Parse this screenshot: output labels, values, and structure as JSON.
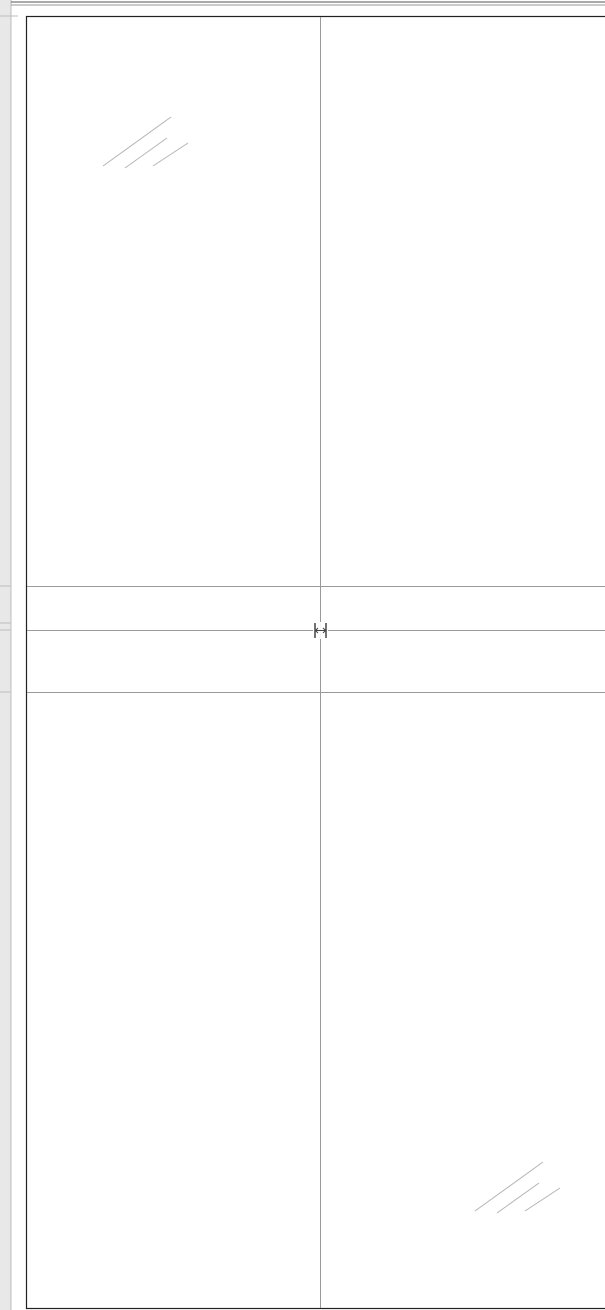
{
  "drawing": {
    "type": "elevation",
    "columns": 2,
    "rows": 3,
    "glass_hatch_marks": 2,
    "resize_handle": "horizontal-resize-icon",
    "colors": {
      "frame": "#222222",
      "division": "#9a9a9a",
      "hatch": "#b4b4b4",
      "gutter": "#e8e8e8",
      "gutter_line": "#bdbdbd"
    }
  }
}
